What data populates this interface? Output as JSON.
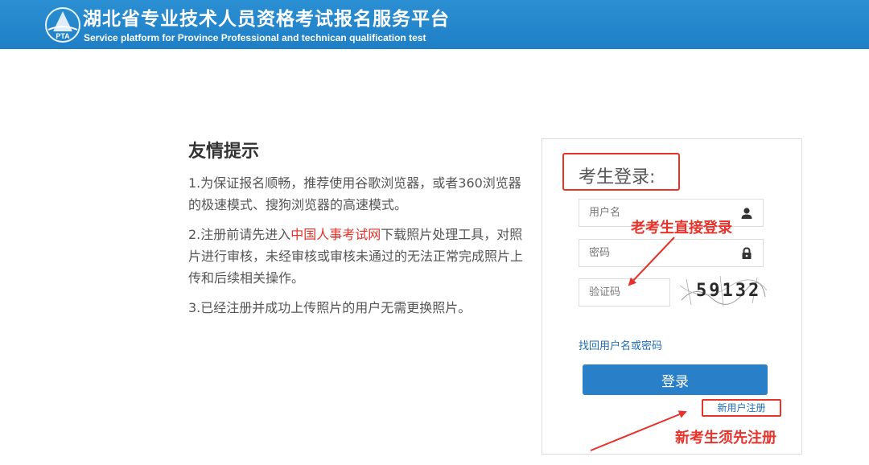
{
  "header": {
    "title": "湖北省专业技术人员资格考试报名服务平台",
    "subtitle": "Service platform for Province Professional and technican qualification test",
    "logo_text": "PTA",
    "bg_color": "#1f7fc6"
  },
  "tips": {
    "title": "友情提示",
    "item1": "1.为保证报名顺畅，推荐使用谷歌浏览器，或者360浏览器的极速模式、搜狗浏览器的高速模式。",
    "item2_before": "2.注册前请先进入",
    "item2_link": "中国人事考试网",
    "item2_after": "下载照片处理工具，对照片进行审核，未经审核或审核未通过的无法正常完成照片上传和后续相关操作。",
    "item3": "3.已经注册并成功上传照片的用户无需更换照片。"
  },
  "login": {
    "title": "考生登录:",
    "username_placeholder": "用户名",
    "password_placeholder": "密码",
    "captcha_placeholder": "验证码",
    "captcha_code": "59132",
    "forgot_link": "找回用户名或密码",
    "login_button": "登录",
    "register_link": "新用户注册"
  },
  "annotations": {
    "existing_user": "老考生直接登录",
    "new_user": "新考生须先注册",
    "color": "#e8322a"
  },
  "icons": {
    "user": "user-icon",
    "lock": "lock-icon"
  }
}
